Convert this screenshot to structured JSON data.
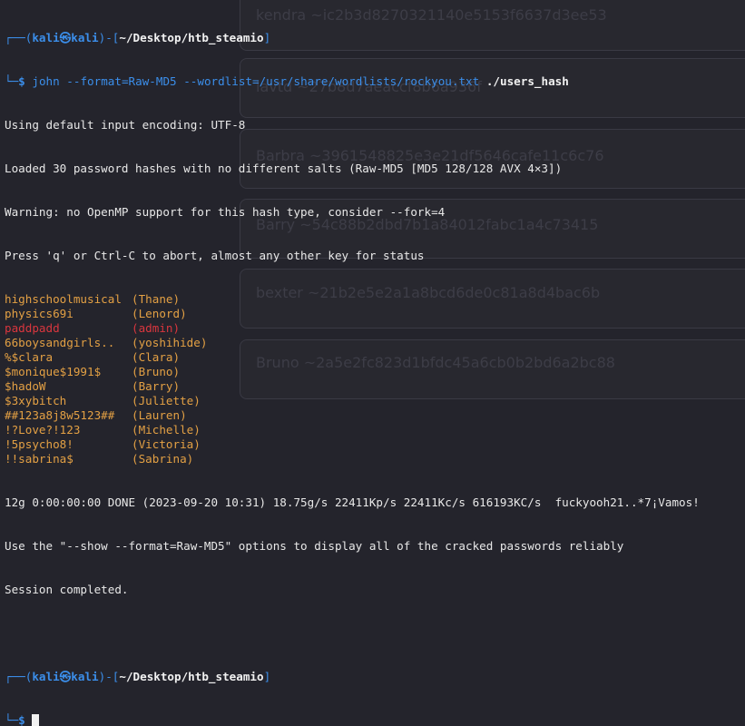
{
  "background": {
    "items": [
      "kendra ~ic2b3d8270321140e5153f6637d3ee53",
      "lavtd ~27b8d7aeaccf8b6a936f",
      "Barbra ~3961548825e3e21df5646cafe11c6c76",
      "Barry ~54c88b2dbd7b1a84012fabc1a4c73415",
      "bexter ~21b2e5e2a1a8bcd6de0c81a8d4bac6b",
      "Bruno ~2a5e2fc823d1bfdc45a6cb0b2bd6a2bc88"
    ]
  },
  "prompt": {
    "top_left": "┌──(",
    "user": "kali㉿kali",
    "mid": ")-[",
    "path": "~/Desktop/htb_steamio",
    "end": "]",
    "bottom": "└─",
    "dollar": "$"
  },
  "command": {
    "cmd": "john",
    "args": "--format=Raw-MD5 --wordlist=/usr/share/wordlists/rockyou.txt",
    "target": "./users_hash"
  },
  "output_head": [
    "Using default input encoding: UTF-8",
    "Loaded 30 password hashes with no different salts (Raw-MD5 [MD5 128/128 AVX 4×3])",
    "Warning: no OpenMP support for this hash type, consider --fork=4",
    "Press 'q' or Ctrl-C to abort, almost any other key for status"
  ],
  "cracked": [
    {
      "password": "highschoolmusical",
      "user": "(Thane)",
      "color": "#e3a044"
    },
    {
      "password": "physics69i",
      "user": "(Lenord)",
      "color": "#e3a044"
    },
    {
      "password": "paddpadd",
      "user": "(admin)",
      "color": "#d9363e"
    },
    {
      "password": "66boysandgirls..",
      "user": "(yoshihide)",
      "color": "#e3a044"
    },
    {
      "password": "%$clara",
      "user": "(Clara)",
      "color": "#e3a044"
    },
    {
      "password": "$monique$1991$",
      "user": "(Bruno)",
      "color": "#e3a044"
    },
    {
      "password": "$hadoW",
      "user": "(Barry)",
      "color": "#e3a044"
    },
    {
      "password": "$3xybitch",
      "user": "(Juliette)",
      "color": "#e3a044"
    },
    {
      "password": "##123a8j8w5123##",
      "user": "(Lauren)",
      "color": "#e3a044"
    },
    {
      "password": "!?Love?!123",
      "user": "(Michelle)",
      "color": "#e3a044"
    },
    {
      "password": "!5psycho8!",
      "user": "(Victoria)",
      "color": "#e3a044"
    },
    {
      "password": "!!sabrina$",
      "user": "(Sabrina)",
      "color": "#e3a044"
    }
  ],
  "output_tail": [
    "12g 0:00:00:00 DONE (2023-09-20 10:31) 18.75g/s 22411Kp/s 22411Kc/s 616193KC/s  fuckyooh21..*7¡Vamos!",
    "Use the \"--show --format=Raw-MD5\" options to display all of the cracked passwords reliably",
    "Session completed."
  ]
}
